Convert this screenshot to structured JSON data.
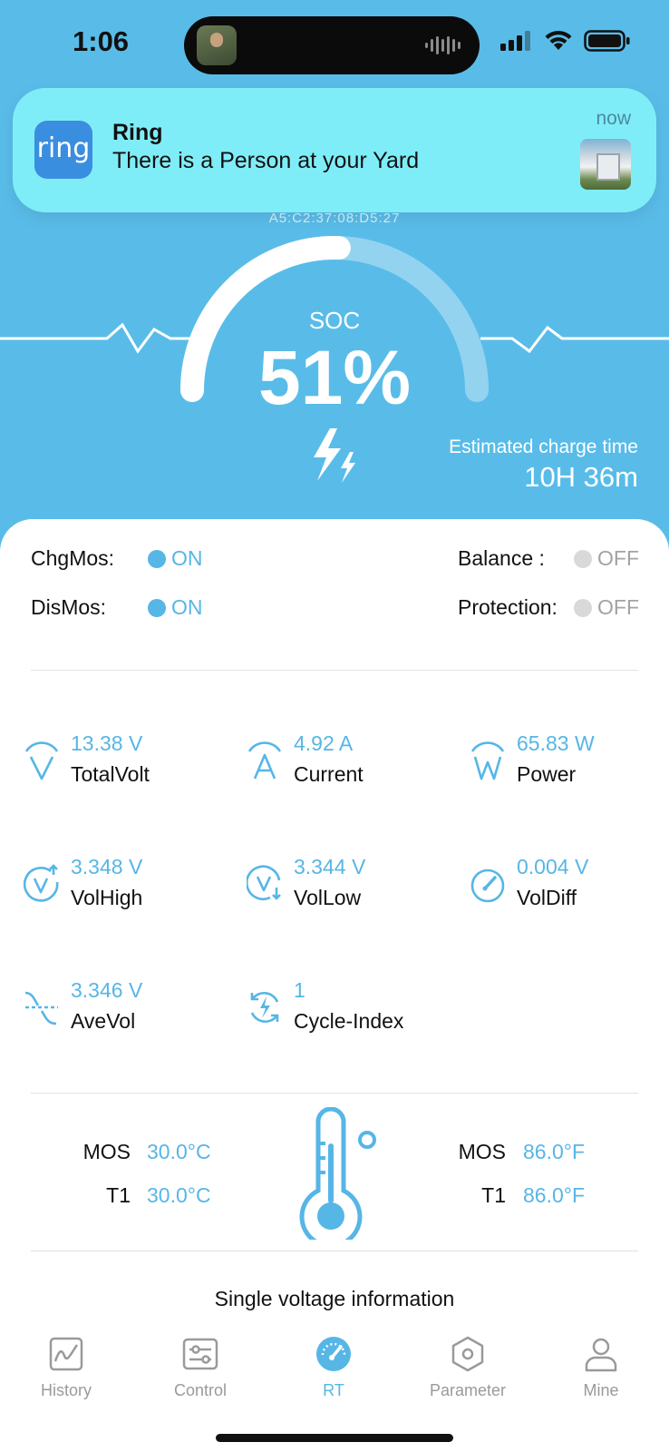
{
  "status_bar": {
    "time": "1:06"
  },
  "notification": {
    "app_icon_text": "ring",
    "app_name": "Ring",
    "message": "There is a Person at your Yard",
    "time": "now"
  },
  "device": {
    "mac_partial": "A5:C2:37:08:D5:27"
  },
  "gauge": {
    "label": "SOC",
    "value": "51%",
    "soc_fraction": 0.51,
    "estimated_label": "Estimated charge time",
    "estimated_value": "10H 36m"
  },
  "states": {
    "chgmos": {
      "label": "ChgMos:",
      "value": "ON"
    },
    "dismos": {
      "label": "DisMos:",
      "value": "ON"
    },
    "balance": {
      "label": "Balance :",
      "value": "OFF"
    },
    "protection": {
      "label": "Protection:",
      "value": "OFF"
    }
  },
  "metrics": [
    {
      "value": "13.38 V",
      "name": "TotalVolt",
      "icon": "volt-icon"
    },
    {
      "value": "4.92 A",
      "name": "Current",
      "icon": "current-icon"
    },
    {
      "value": "65.83 W",
      "name": "Power",
      "icon": "power-icon"
    },
    {
      "value": "3.348 V",
      "name": "VolHigh",
      "icon": "vol-high-icon"
    },
    {
      "value": "3.344 V",
      "name": "VolLow",
      "icon": "vol-low-icon"
    },
    {
      "value": "0.004 V",
      "name": "VolDiff",
      "icon": "gauge-icon"
    },
    {
      "value": "3.346 V",
      "name": "AveVol",
      "icon": "average-icon"
    },
    {
      "value": "1",
      "name": "Cycle-Index",
      "icon": "cycle-icon"
    }
  ],
  "temperatures": {
    "celsius": [
      {
        "label": "MOS",
        "value": "30.0°C"
      },
      {
        "label": "T1",
        "value": "30.0°C"
      }
    ],
    "fahrenheit": [
      {
        "label": "MOS",
        "value": "86.0°F"
      },
      {
        "label": "T1",
        "value": "86.0°F"
      }
    ]
  },
  "single_voltage_title": "Single voltage information",
  "tabs": [
    {
      "label": "History",
      "icon": "history-chart-icon",
      "active": false
    },
    {
      "label": "Control",
      "icon": "sliders-icon",
      "active": false
    },
    {
      "label": "RT",
      "icon": "speedometer-icon",
      "active": true
    },
    {
      "label": "Parameter",
      "icon": "hexagon-icon",
      "active": false
    },
    {
      "label": "Mine",
      "icon": "person-icon",
      "active": false
    }
  ],
  "colors": {
    "background": "#59BCE8",
    "accent": "#56B6E6",
    "notification": "#7FEDF8",
    "off": "#D9D9D9"
  }
}
